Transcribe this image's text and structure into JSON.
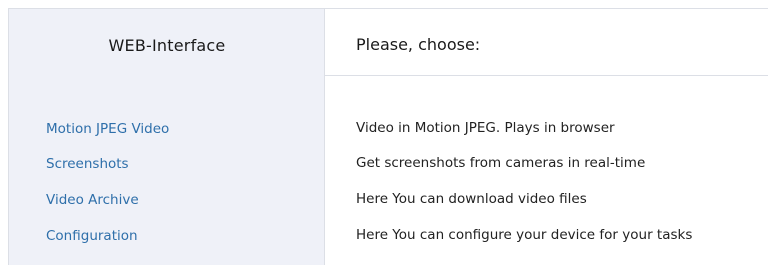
{
  "sidebar": {
    "title": "WEB-Interface",
    "items": [
      {
        "label": "Motion JPEG Video"
      },
      {
        "label": "Screenshots"
      },
      {
        "label": "Video Archive"
      },
      {
        "label": "Configuration"
      }
    ]
  },
  "main": {
    "title": "Please, choose:",
    "descriptions": [
      {
        "text": "Video in Motion JPEG. Plays in browser"
      },
      {
        "text": "Get screenshots from cameras in real-time"
      },
      {
        "text": "Here You can download video files"
      },
      {
        "text": "Here You can configure your device for your tasks"
      }
    ]
  },
  "colors": {
    "sidebar_bg": "#eff1f8",
    "link": "#2e6faa",
    "border": "#dcdfe6"
  }
}
